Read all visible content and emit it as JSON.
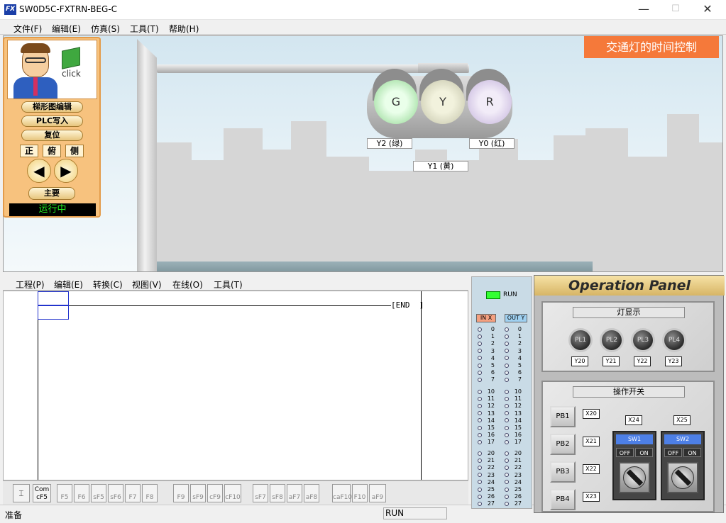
{
  "window": {
    "title": "SW0D5C-FXTRN-BEG-C",
    "icon": "fx-app-icon",
    "minimize": "—",
    "maximize": "☐",
    "close": "✕"
  },
  "menu": [
    "文件(F)",
    "编辑(E)",
    "仿真(S)",
    "工具(T)",
    "帮助(H)"
  ],
  "scene": {
    "title": "交通灯的时间控制",
    "lamps": [
      "G",
      "Y",
      "R"
    ],
    "labels": {
      "green": "Y2 (绿)",
      "red": "Y0 (红)",
      "yellow": "Y1 (黄)"
    }
  },
  "control": {
    "click": "click",
    "ladder_edit": "梯形图编辑",
    "plc_write": "PLC写入",
    "reset": "复位",
    "views": [
      "正",
      "俯",
      "侧"
    ],
    "prev": "◀",
    "next": "▶",
    "main": "主要",
    "status": "运行中"
  },
  "ladder": {
    "menu": [
      "工程(P)",
      "编辑(E)",
      "转换(C)",
      "视图(V)",
      "在线(O)",
      "工具(T)"
    ],
    "end": "END"
  },
  "toolbar": {
    "buttons": [
      "Com\ncF5",
      "F5",
      "F6",
      "sF5",
      "sF6",
      "F7",
      "F8",
      "F9",
      "sF9",
      "cF9",
      "cF10",
      "sF7",
      "sF8",
      "aF7",
      "aF8",
      "caF10",
      "F10",
      "aF9"
    ]
  },
  "statusbar": {
    "ready": "准备",
    "mode": "RUN"
  },
  "io": {
    "run": "RUN",
    "in_label": "IN X",
    "out_label": "OUT Y",
    "groups": [
      [
        "0",
        "1",
        "2",
        "3",
        "4",
        "5",
        "6",
        "7"
      ],
      [
        "10",
        "11",
        "12",
        "13",
        "14",
        "15",
        "16",
        "17"
      ],
      [
        "20",
        "21",
        "22",
        "23",
        "24",
        "25",
        "26",
        "27"
      ]
    ]
  },
  "op": {
    "title": "Operation Panel",
    "lights_title": "灯显示",
    "lights": [
      {
        "name": "PL1",
        "tag": "Y20"
      },
      {
        "name": "PL2",
        "tag": "Y21"
      },
      {
        "name": "PL3",
        "tag": "Y22"
      },
      {
        "name": "PL4",
        "tag": "Y23"
      }
    ],
    "switch_title": "操作开关",
    "pbs": [
      {
        "name": "PB1",
        "tag": "X20"
      },
      {
        "name": "PB2",
        "tag": "X21"
      },
      {
        "name": "PB3",
        "tag": "X22"
      },
      {
        "name": "PB4",
        "tag": "X23"
      }
    ],
    "sws": [
      {
        "name": "SW1",
        "tag": "X24",
        "off": "OFF",
        "on": "ON"
      },
      {
        "name": "SW2",
        "tag": "X25",
        "off": "OFF",
        "on": "ON"
      }
    ]
  }
}
